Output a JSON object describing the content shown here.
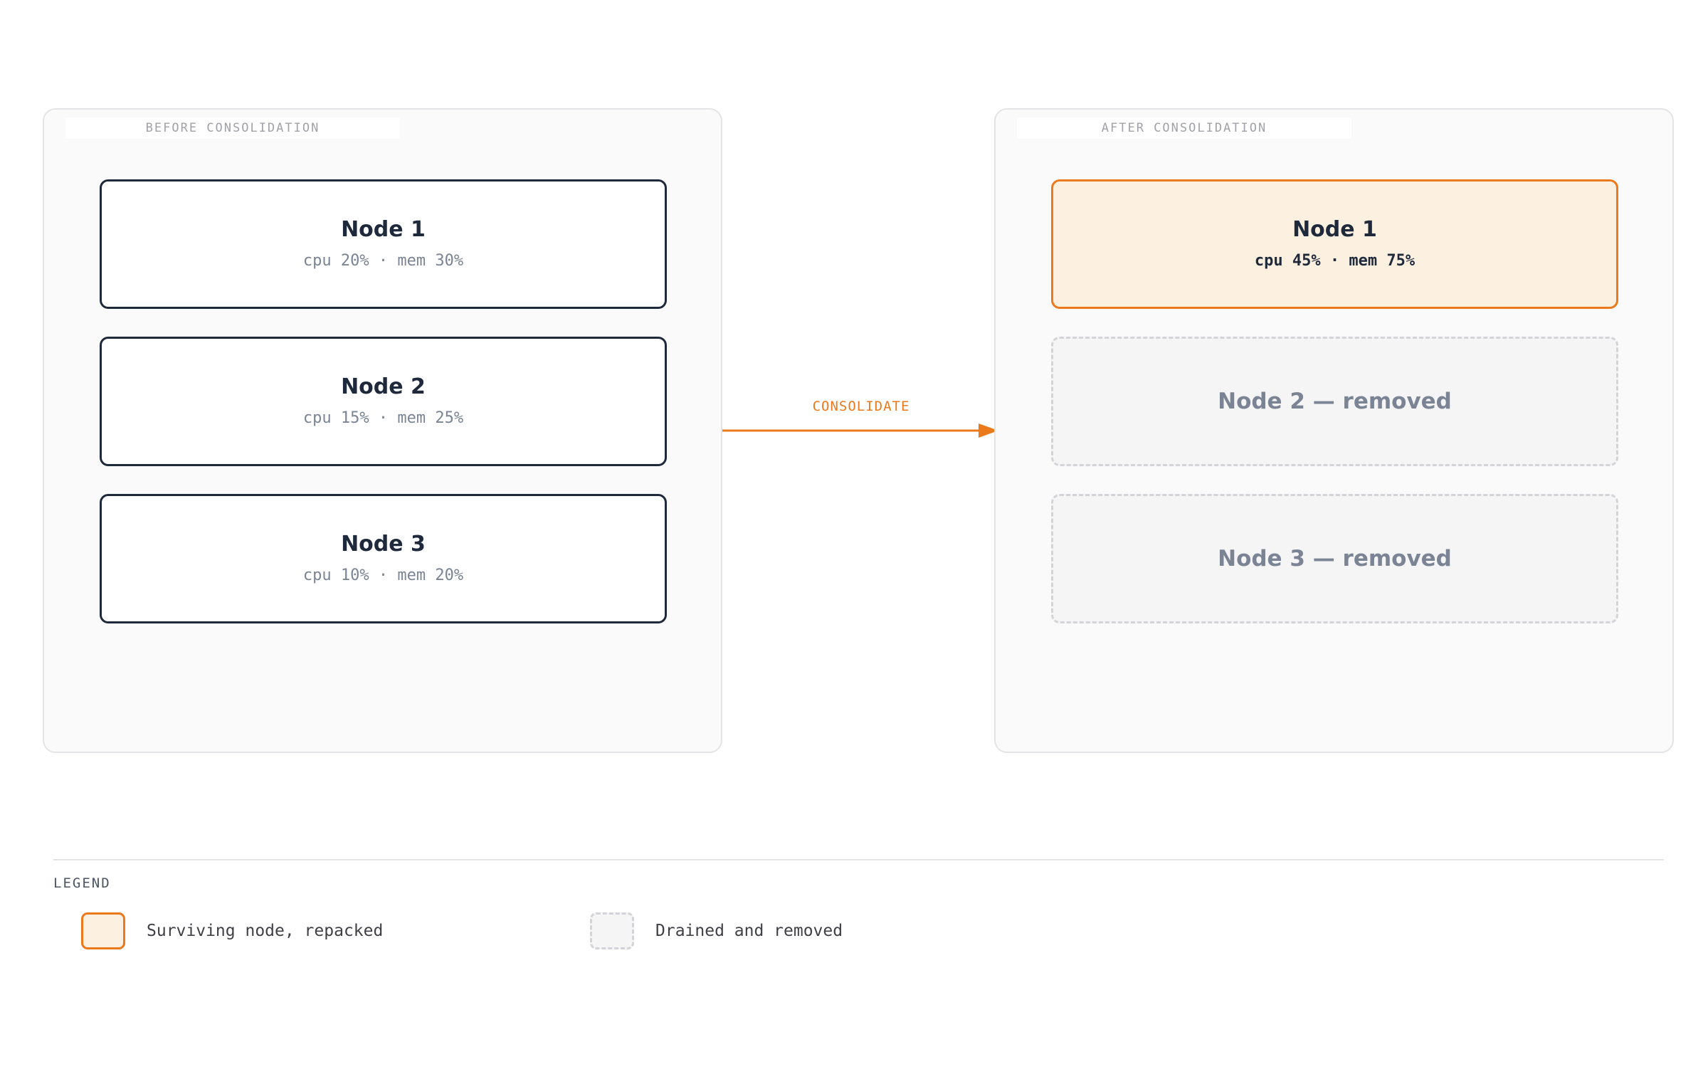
{
  "before": {
    "label": "BEFORE CONSOLIDATION",
    "nodes": [
      {
        "title": "Node 1",
        "usage": "cpu 20% · mem 30%"
      },
      {
        "title": "Node 2",
        "usage": "cpu 15% · mem 25%"
      },
      {
        "title": "Node 3",
        "usage": "cpu 10% · mem 20%"
      }
    ]
  },
  "after": {
    "label": "AFTER CONSOLIDATION",
    "nodes": [
      {
        "title": "Node 1",
        "usage": "cpu 45% · mem 75%"
      },
      {
        "title": "Node 2 — removed"
      },
      {
        "title": "Node 3 — removed"
      }
    ]
  },
  "arrow": {
    "label": "CONSOLIDATE"
  },
  "legend": {
    "title": "LEGEND",
    "items": [
      {
        "label": "Surviving node, repacked"
      },
      {
        "label": "Drained and removed"
      }
    ]
  },
  "colors": {
    "accent": "#ec7a1c",
    "survivor_fill": "#fcf1e1",
    "node_border": "#1e293b",
    "removed_border": "#d4d4d8",
    "panel_bg": "#fafafa"
  }
}
